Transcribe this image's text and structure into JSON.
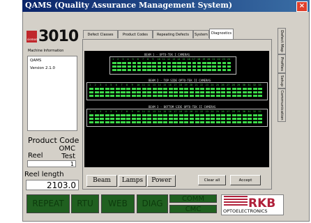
{
  "window": {
    "title": "QAMS (Quality Assurance Management System)",
    "close": "×"
  },
  "logo": {
    "number": "3010",
    "badge": "siemens"
  },
  "machine_info": {
    "label": "Machine Information",
    "items": [
      "QAMS",
      "Version 2.1.0"
    ]
  },
  "product_code": {
    "label": "Product Code",
    "value": "OMC Test"
  },
  "reel": {
    "label": "Reel",
    "value": "1"
  },
  "reel_length": {
    "label": "Reel length",
    "value": "2103.0"
  },
  "tabs": [
    {
      "label": "Defect Classes"
    },
    {
      "label": "Product Codes"
    },
    {
      "label": "Repeating Defects"
    },
    {
      "label": "System"
    },
    {
      "label": "Diagnostics"
    }
  ],
  "right_tabs": [
    {
      "label": "Defect Map"
    },
    {
      "label": "Profiles"
    },
    {
      "label": "Setup"
    },
    {
      "label": "Communication"
    }
  ],
  "diagnostics": {
    "beams": [
      {
        "title": "BEAM 1 - OPTO-TEK I CAMERAS",
        "cameras": 24,
        "rows": 3
      },
      {
        "title": "BEAM 2 - TOP SIDE OPTO-TEK II CAMERAS",
        "cameras": 33,
        "rows": 3
      },
      {
        "title": "BEAM 3 - BOTTOM SIDE OPTO-TEK II CAMERAS",
        "cameras": 33,
        "rows": 3
      }
    ]
  },
  "buttons": {
    "beam": "Beam",
    "lamps": "Lamps",
    "power": "Power",
    "clear_all": "Clear all",
    "accept": "Accept"
  },
  "status": {
    "repeat": "REPEAT",
    "rtu": "RTU",
    "web": "WEB",
    "diag": "DIAG",
    "comm": "COMM",
    "cmc": "CMC"
  },
  "brand": {
    "name": "RKB",
    "sub": "OPTOELECTRONICS"
  }
}
